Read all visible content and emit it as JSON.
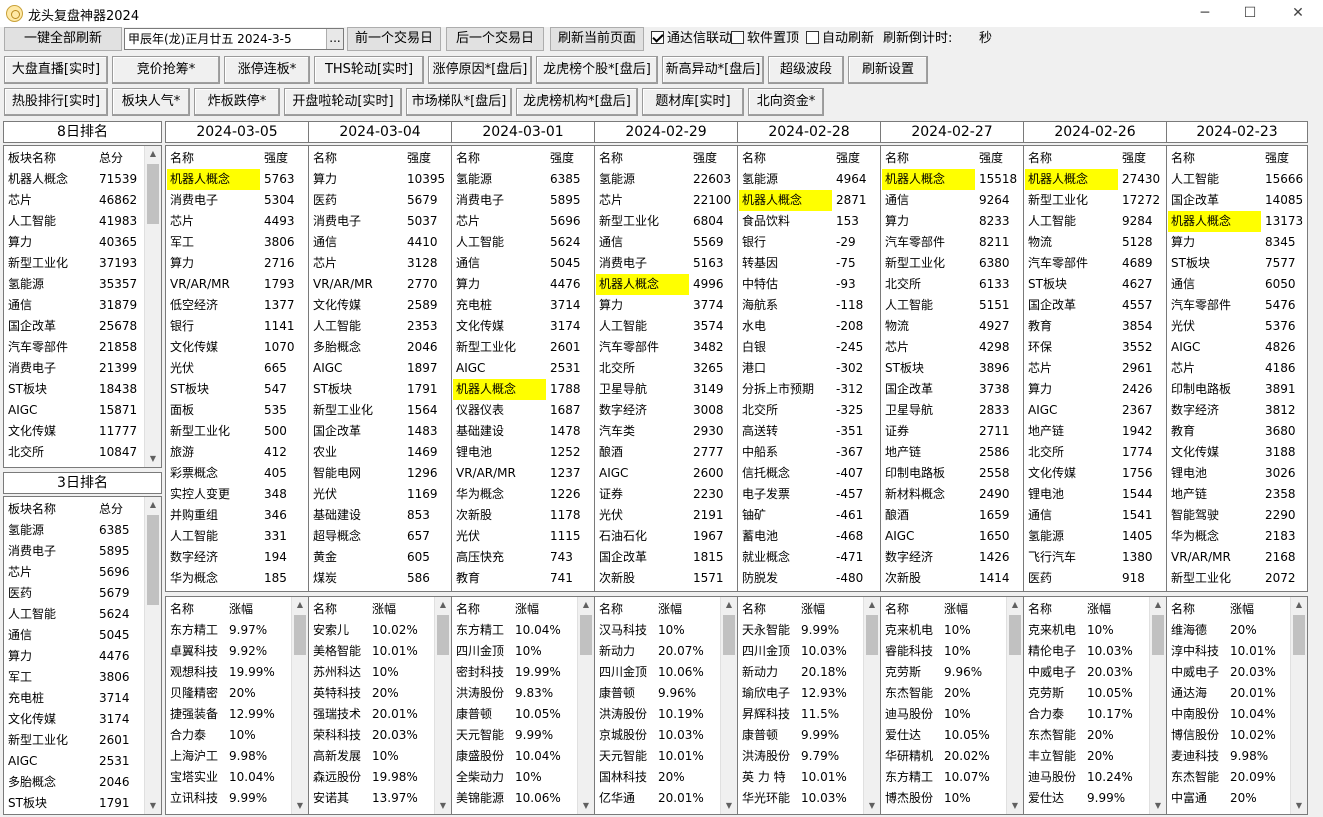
{
  "window": {
    "title": "龙头复盘神器2024",
    "minimize": "─",
    "maximize": "☐",
    "close": "✕"
  },
  "toolbar": {
    "refresh_all": "一键全部刷新",
    "date_value": "甲辰年(龙)正月廿五  2024-3-5",
    "date_dropdown": "...",
    "prev_day": "前一个交易日",
    "next_day": "后一个交易日",
    "refresh_page": "刷新当前页面",
    "chk_tdx": "通达信联动",
    "chk_top": "软件置顶",
    "chk_auto": "自动刷新",
    "countdown_label": "刷新倒计时:",
    "countdown_unit": "秒",
    "row1": [
      "大盘直播[实时]",
      "竞价抢筹*",
      "涨停连板*",
      "THS轮动[实时]",
      "涨停原因*[盘后]",
      "龙虎榜个股*[盘后]",
      "新高异动*[盘后]",
      "超级波段",
      "刷新设置"
    ],
    "row2": [
      "热股排行[实时]",
      "板块人气*",
      "炸板跌停*",
      "开盘啦轮动[实时]",
      "市场梯队*[盘后]",
      "龙虎榜机构*[盘后]",
      "题材库[实时]",
      "北向资金*"
    ]
  },
  "rank8": {
    "title": "8日排名",
    "col_name": "板块名称",
    "col_score": "总分",
    "rows": [
      [
        "机器人概念",
        "71539"
      ],
      [
        "芯片",
        "46862"
      ],
      [
        "人工智能",
        "41983"
      ],
      [
        "算力",
        "40365"
      ],
      [
        "新型工业化",
        "37193"
      ],
      [
        "氢能源",
        "35357"
      ],
      [
        "通信",
        "31879"
      ],
      [
        "国企改革",
        "25678"
      ],
      [
        "汽车零部件",
        "21858"
      ],
      [
        "消费电子",
        "21399"
      ],
      [
        "ST板块",
        "18438"
      ],
      [
        "AIGC",
        "15871"
      ],
      [
        "文化传媒",
        "11777"
      ],
      [
        "北交所",
        "10847"
      ]
    ]
  },
  "rank3": {
    "title": "3日排名",
    "col_name": "板块名称",
    "col_score": "总分",
    "rows": [
      [
        "氢能源",
        "6385"
      ],
      [
        "消费电子",
        "5895"
      ],
      [
        "芯片",
        "5696"
      ],
      [
        "医药",
        "5679"
      ],
      [
        "人工智能",
        "5624"
      ],
      [
        "通信",
        "5045"
      ],
      [
        "算力",
        "4476"
      ],
      [
        "军工",
        "3806"
      ],
      [
        "充电桩",
        "3714"
      ],
      [
        "文化传媒",
        "3174"
      ],
      [
        "新型工业化",
        "2601"
      ],
      [
        "AIGC",
        "2531"
      ],
      [
        "多胎概念",
        "2046"
      ],
      [
        "ST板块",
        "1791"
      ]
    ]
  },
  "days": [
    {
      "date": "2024-03-05",
      "col_name": "名称",
      "col_value": "强度",
      "sectors": [
        [
          "机器人概念",
          "5763"
        ],
        [
          "消费电子",
          "5304"
        ],
        [
          "芯片",
          "4493"
        ],
        [
          "军工",
          "3806"
        ],
        [
          "算力",
          "2716"
        ],
        [
          "VR/AR/MR",
          "1793"
        ],
        [
          "低空经济",
          "1377"
        ],
        [
          "银行",
          "1141"
        ],
        [
          "文化传媒",
          "1070"
        ],
        [
          "光伏",
          "665"
        ],
        [
          "ST板块",
          "547"
        ],
        [
          "面板",
          "535"
        ],
        [
          "新型工业化",
          "500"
        ],
        [
          "旅游",
          "412"
        ],
        [
          "彩票概念",
          "405"
        ],
        [
          "实控人变更",
          "348"
        ],
        [
          "并购重组",
          "346"
        ],
        [
          "人工智能",
          "331"
        ],
        [
          "数字经济",
          "194"
        ],
        [
          "华为概念",
          "185"
        ]
      ],
      "col_stock": "名称",
      "col_pct": "涨幅",
      "stocks": [
        [
          "东方精工",
          "9.97%"
        ],
        [
          "卓翼科技",
          "9.92%"
        ],
        [
          "观想科技",
          "19.99%"
        ],
        [
          "贝隆精密",
          "20%"
        ],
        [
          "捷强装备",
          "12.99%"
        ],
        [
          "合力泰",
          "10%"
        ],
        [
          "上海沪工",
          "9.98%"
        ],
        [
          "宝塔实业",
          "10.04%"
        ],
        [
          "立讯科技",
          "9.99%"
        ]
      ]
    },
    {
      "date": "2024-03-04",
      "col_name": "名称",
      "col_value": "强度",
      "sectors": [
        [
          "算力",
          "10395"
        ],
        [
          "医药",
          "5679"
        ],
        [
          "消费电子",
          "5037"
        ],
        [
          "通信",
          "4410"
        ],
        [
          "芯片",
          "3128"
        ],
        [
          "VR/AR/MR",
          "2770"
        ],
        [
          "文化传媒",
          "2589"
        ],
        [
          "人工智能",
          "2353"
        ],
        [
          "多胎概念",
          "2046"
        ],
        [
          "AIGC",
          "1897"
        ],
        [
          "ST板块",
          "1791"
        ],
        [
          "新型工业化",
          "1564"
        ],
        [
          "国企改革",
          "1483"
        ],
        [
          "农业",
          "1469"
        ],
        [
          "智能电网",
          "1296"
        ],
        [
          "光伏",
          "1169"
        ],
        [
          "基础建设",
          "853"
        ],
        [
          "超导概念",
          "657"
        ],
        [
          "黄金",
          "605"
        ],
        [
          "煤炭",
          "586"
        ]
      ],
      "col_stock": "名称",
      "col_pct": "涨幅",
      "stocks": [
        [
          "安索儿",
          "10.02%"
        ],
        [
          "美格智能",
          "10.01%"
        ],
        [
          "苏州科达",
          "10%"
        ],
        [
          "英特科技",
          "20%"
        ],
        [
          "强瑞技术",
          "20.01%"
        ],
        [
          "荣科科技",
          "20.03%"
        ],
        [
          "高新发展",
          "10%"
        ],
        [
          "森远股份",
          "19.98%"
        ],
        [
          "安诺其",
          "13.97%"
        ]
      ]
    },
    {
      "date": "2024-03-01",
      "col_name": "名称",
      "col_value": "强度",
      "sectors": [
        [
          "氢能源",
          "6385"
        ],
        [
          "消费电子",
          "5895"
        ],
        [
          "芯片",
          "5696"
        ],
        [
          "人工智能",
          "5624"
        ],
        [
          "通信",
          "5045"
        ],
        [
          "算力",
          "4476"
        ],
        [
          "充电桩",
          "3714"
        ],
        [
          "文化传媒",
          "3174"
        ],
        [
          "新型工业化",
          "2601"
        ],
        [
          "AIGC",
          "2531"
        ],
        [
          "机器人概念",
          "1788"
        ],
        [
          "仪器仪表",
          "1687"
        ],
        [
          "基础建设",
          "1478"
        ],
        [
          "锂电池",
          "1252"
        ],
        [
          "VR/AR/MR",
          "1237"
        ],
        [
          "华为概念",
          "1226"
        ],
        [
          "次新股",
          "1178"
        ],
        [
          "光伏",
          "1115"
        ],
        [
          "高压快充",
          "743"
        ],
        [
          "教育",
          "741"
        ]
      ],
      "col_stock": "名称",
      "col_pct": "涨幅",
      "stocks": [
        [
          "东方精工",
          "10.04%"
        ],
        [
          "四川金顶",
          "10%"
        ],
        [
          "密封科技",
          "19.99%"
        ],
        [
          "洪涛股份",
          "9.83%"
        ],
        [
          "康普顿",
          "10.05%"
        ],
        [
          "天元智能",
          "9.99%"
        ],
        [
          "康盛股份",
          "10.04%"
        ],
        [
          "全柴动力",
          "10%"
        ],
        [
          "美锦能源",
          "10.06%"
        ]
      ]
    },
    {
      "date": "2024-02-29",
      "col_name": "名称",
      "col_value": "强度",
      "sectors": [
        [
          "氢能源",
          "22603"
        ],
        [
          "芯片",
          "22100"
        ],
        [
          "新型工业化",
          "6804"
        ],
        [
          "通信",
          "5569"
        ],
        [
          "消费电子",
          "5163"
        ],
        [
          "机器人概念",
          "4996"
        ],
        [
          "算力",
          "3774"
        ],
        [
          "人工智能",
          "3574"
        ],
        [
          "汽车零部件",
          "3482"
        ],
        [
          "北交所",
          "3265"
        ],
        [
          "卫星导航",
          "3149"
        ],
        [
          "数字经济",
          "3008"
        ],
        [
          "汽车类",
          "2930"
        ],
        [
          "酿酒",
          "2777"
        ],
        [
          "AIGC",
          "2600"
        ],
        [
          "证券",
          "2230"
        ],
        [
          "光伏",
          "2191"
        ],
        [
          "石油石化",
          "1967"
        ],
        [
          "国企改革",
          "1815"
        ],
        [
          "次新股",
          "1571"
        ]
      ],
      "col_stock": "名称",
      "col_pct": "涨幅",
      "stocks": [
        [
          "汉马科技",
          "10%"
        ],
        [
          "新动力",
          "20.07%"
        ],
        [
          "四川金顶",
          "10.06%"
        ],
        [
          "康普顿",
          "9.96%"
        ],
        [
          "洪涛股份",
          "10.19%"
        ],
        [
          "京城股份",
          "10.03%"
        ],
        [
          "天元智能",
          "10.01%"
        ],
        [
          "国林科技",
          "20%"
        ],
        [
          "亿华通",
          "20.01%"
        ]
      ]
    },
    {
      "date": "2024-02-28",
      "col_name": "名称",
      "col_value": "强度",
      "sectors": [
        [
          "氢能源",
          "4964"
        ],
        [
          "机器人概念",
          "2871"
        ],
        [
          "食品饮料",
          "153"
        ],
        [
          "银行",
          "-29"
        ],
        [
          "转基因",
          "-75"
        ],
        [
          "中特估",
          "-93"
        ],
        [
          "海航系",
          "-118"
        ],
        [
          "水电",
          "-208"
        ],
        [
          "白银",
          "-245"
        ],
        [
          "港口",
          "-302"
        ],
        [
          "分拆上市预期",
          "-312"
        ],
        [
          "北交所",
          "-325"
        ],
        [
          "高送转",
          "-351"
        ],
        [
          "中船系",
          "-367"
        ],
        [
          "信托概念",
          "-407"
        ],
        [
          "电子发票",
          "-457"
        ],
        [
          "铀矿",
          "-461"
        ],
        [
          "蓄电池",
          "-468"
        ],
        [
          "就业概念",
          "-471"
        ],
        [
          "防脱发",
          "-480"
        ]
      ],
      "col_stock": "名称",
      "col_pct": "涨幅",
      "stocks": [
        [
          "天永智能",
          "9.99%"
        ],
        [
          "四川金顶",
          "10.03%"
        ],
        [
          "新动力",
          "20.18%"
        ],
        [
          "瑜欣电子",
          "12.93%"
        ],
        [
          "昇辉科技",
          "11.5%"
        ],
        [
          "康普顿",
          "9.99%"
        ],
        [
          "洪涛股份",
          "9.79%"
        ],
        [
          "英 力 特",
          "10.01%"
        ],
        [
          "华光环能",
          "10.03%"
        ]
      ]
    },
    {
      "date": "2024-02-27",
      "col_name": "名称",
      "col_value": "强度",
      "sectors": [
        [
          "机器人概念",
          "15518"
        ],
        [
          "通信",
          "9264"
        ],
        [
          "算力",
          "8233"
        ],
        [
          "汽车零部件",
          "8211"
        ],
        [
          "新型工业化",
          "6380"
        ],
        [
          "北交所",
          "6133"
        ],
        [
          "人工智能",
          "5151"
        ],
        [
          "物流",
          "4927"
        ],
        [
          "芯片",
          "4298"
        ],
        [
          "ST板块",
          "3896"
        ],
        [
          "国企改革",
          "3738"
        ],
        [
          "卫星导航",
          "2833"
        ],
        [
          "证券",
          "2711"
        ],
        [
          "地产链",
          "2586"
        ],
        [
          "印制电路板",
          "2558"
        ],
        [
          "新材料概念",
          "2490"
        ],
        [
          "酿酒",
          "1659"
        ],
        [
          "AIGC",
          "1650"
        ],
        [
          "数字经济",
          "1426"
        ],
        [
          "次新股",
          "1414"
        ]
      ],
      "col_stock": "名称",
      "col_pct": "涨幅",
      "stocks": [
        [
          "克来机电",
          "10%"
        ],
        [
          "睿能科技",
          "10%"
        ],
        [
          "克劳斯",
          "9.96%"
        ],
        [
          "东杰智能",
          "20%"
        ],
        [
          "迪马股份",
          "10%"
        ],
        [
          "爱仕达",
          "10.05%"
        ],
        [
          "华研精机",
          "20.02%"
        ],
        [
          "东方精工",
          "10.07%"
        ],
        [
          "博杰股份",
          "10%"
        ]
      ]
    },
    {
      "date": "2024-02-26",
      "col_name": "名称",
      "col_value": "强度",
      "sectors": [
        [
          "机器人概念",
          "27430"
        ],
        [
          "新型工业化",
          "17272"
        ],
        [
          "人工智能",
          "9284"
        ],
        [
          "物流",
          "5128"
        ],
        [
          "汽车零部件",
          "4689"
        ],
        [
          "ST板块",
          "4627"
        ],
        [
          "国企改革",
          "4557"
        ],
        [
          "教育",
          "3854"
        ],
        [
          "环保",
          "3552"
        ],
        [
          "芯片",
          "2961"
        ],
        [
          "算力",
          "2426"
        ],
        [
          "AIGC",
          "2367"
        ],
        [
          "地产链",
          "1942"
        ],
        [
          "北交所",
          "1774"
        ],
        [
          "文化传媒",
          "1756"
        ],
        [
          "锂电池",
          "1544"
        ],
        [
          "通信",
          "1541"
        ],
        [
          "氢能源",
          "1405"
        ],
        [
          "飞行汽车",
          "1380"
        ],
        [
          "医药",
          "918"
        ]
      ],
      "col_stock": "名称",
      "col_pct": "涨幅",
      "stocks": [
        [
          "克来机电",
          "10%"
        ],
        [
          "精伦电子",
          "10.03%"
        ],
        [
          "中威电子",
          "20.03%"
        ],
        [
          "克劳斯",
          "10.05%"
        ],
        [
          "合力泰",
          "10.17%"
        ],
        [
          "东杰智能",
          "20%"
        ],
        [
          "丰立智能",
          "20%"
        ],
        [
          "迪马股份",
          "10.24%"
        ],
        [
          "爱仕达",
          "9.99%"
        ]
      ]
    },
    {
      "date": "2024-02-23",
      "col_name": "名称",
      "col_value": "强度",
      "sectors": [
        [
          "人工智能",
          "15666"
        ],
        [
          "国企改革",
          "14085"
        ],
        [
          "机器人概念",
          "13173"
        ],
        [
          "算力",
          "8345"
        ],
        [
          "ST板块",
          "7577"
        ],
        [
          "通信",
          "6050"
        ],
        [
          "汽车零部件",
          "5476"
        ],
        [
          "光伏",
          "5376"
        ],
        [
          "AIGC",
          "4826"
        ],
        [
          "芯片",
          "4186"
        ],
        [
          "印制电路板",
          "3891"
        ],
        [
          "数字经济",
          "3812"
        ],
        [
          "教育",
          "3680"
        ],
        [
          "文化传媒",
          "3188"
        ],
        [
          "锂电池",
          "3026"
        ],
        [
          "地产链",
          "2358"
        ],
        [
          "智能驾驶",
          "2290"
        ],
        [
          "华为概念",
          "2183"
        ],
        [
          "VR/AR/MR",
          "2168"
        ],
        [
          "新型工业化",
          "2072"
        ]
      ],
      "col_stock": "名称",
      "col_pct": "涨幅",
      "stocks": [
        [
          "维海德",
          "20%"
        ],
        [
          "淳中科技",
          "10.01%"
        ],
        [
          "中威电子",
          "20.03%"
        ],
        [
          "通达海",
          "20.01%"
        ],
        [
          "中南股份",
          "10.04%"
        ],
        [
          "博信股份",
          "10.02%"
        ],
        [
          "麦迪科技",
          "9.98%"
        ],
        [
          "东杰智能",
          "20.09%"
        ],
        [
          "中富通",
          "20%"
        ]
      ]
    }
  ],
  "highlight_sector": "机器人概念",
  "colors": {
    "highlight": "#ffff00",
    "border": "#7a7a7a",
    "background": "#f0f0f0"
  },
  "icons": [
    "app-logo-icon",
    "minimize-icon",
    "maximize-icon",
    "close-icon",
    "scroll-up-icon",
    "scroll-down-icon",
    "checkbox-icon"
  ]
}
